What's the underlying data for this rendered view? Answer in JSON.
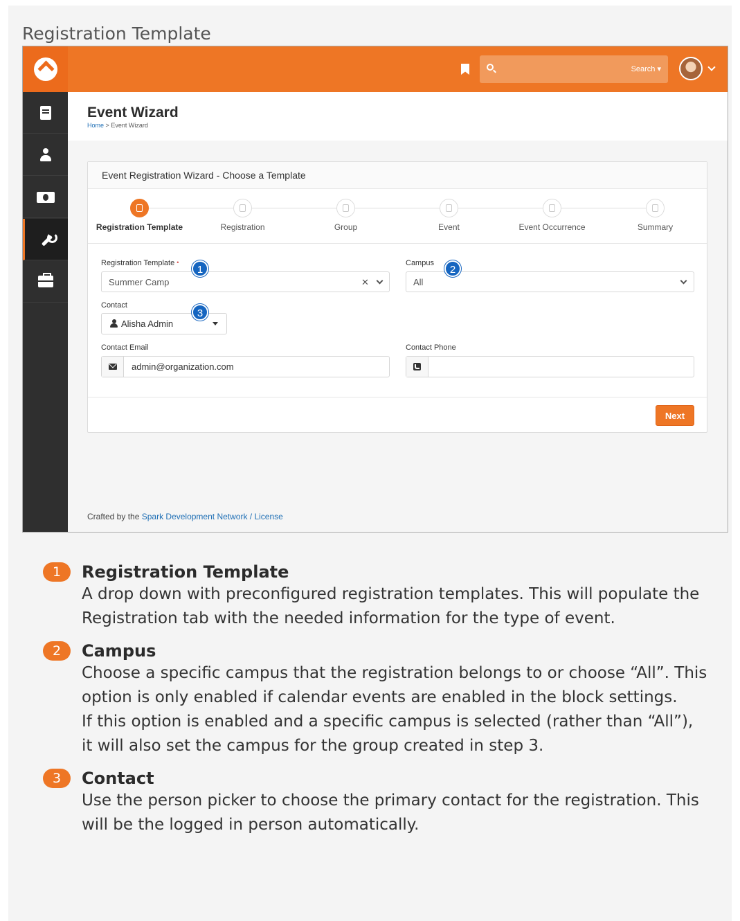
{
  "doc": {
    "section_title": "Registration Template"
  },
  "app": {
    "search_button": "Search ▾",
    "page_title": "Event Wizard",
    "breadcrumb": {
      "home": "Home",
      "sep": ">",
      "current": "Event Wizard"
    },
    "sidebar": [
      {
        "icon": "book-icon",
        "active": false
      },
      {
        "icon": "person-icon",
        "active": false
      },
      {
        "icon": "money-icon",
        "active": false
      },
      {
        "icon": "wrench-icon",
        "active": true
      },
      {
        "icon": "briefcase-icon",
        "active": false
      }
    ],
    "colors": {
      "brand": "#ee7625",
      "sidebar": "#2f2f2f",
      "link": "#1f6fb5",
      "callout": "#1565c0"
    }
  },
  "wizard": {
    "heading": "Event Registration Wizard - Choose a Template",
    "steps": [
      {
        "label": "Registration Template",
        "icon": "clipboard-icon",
        "active": true
      },
      {
        "label": "Registration",
        "icon": "file-icon",
        "active": false
      },
      {
        "label": "Group",
        "icon": "users-icon",
        "active": false
      },
      {
        "label": "Event",
        "icon": "calendar-icon",
        "active": false
      },
      {
        "label": "Event Occurrence",
        "icon": "clock-icon",
        "active": false
      },
      {
        "label": "Summary",
        "icon": "list-icon",
        "active": false
      }
    ],
    "fields": {
      "template": {
        "label": "Registration Template",
        "required": "•",
        "value": "Summer Camp",
        "clear": "✕"
      },
      "campus": {
        "label": "Campus",
        "value": "All"
      },
      "contact": {
        "label": "Contact",
        "value": "Alisha Admin"
      },
      "email": {
        "label": "Contact Email",
        "value": "admin@organization.com"
      },
      "phone": {
        "label": "Contact Phone",
        "value": ""
      }
    },
    "next_button": "Next",
    "callouts": [
      "1",
      "2",
      "3"
    ]
  },
  "footer": {
    "prefix": "Crafted by the ",
    "link1": "Spark Development Network",
    "sep": " / ",
    "link2": "License"
  },
  "notes": [
    {
      "num": "1",
      "title": "Registration Template",
      "lines": [
        "A drop down with preconfigured registration templates. This will populate the Registration tab with the needed information for the type of event."
      ]
    },
    {
      "num": "2",
      "title": "Campus",
      "lines": [
        "Choose a specific campus that the registration belongs to or choose “All”. This option is only enabled if calendar events are enabled in the block settings.",
        "If this option is enabled and a specific campus is selected (rather than “All”), it will also set the campus for the group created in step 3."
      ]
    },
    {
      "num": "3",
      "title": "Contact",
      "lines": [
        "Use the person picker to choose the primary contact for the registration. This will be the logged in person automatically."
      ]
    }
  ]
}
